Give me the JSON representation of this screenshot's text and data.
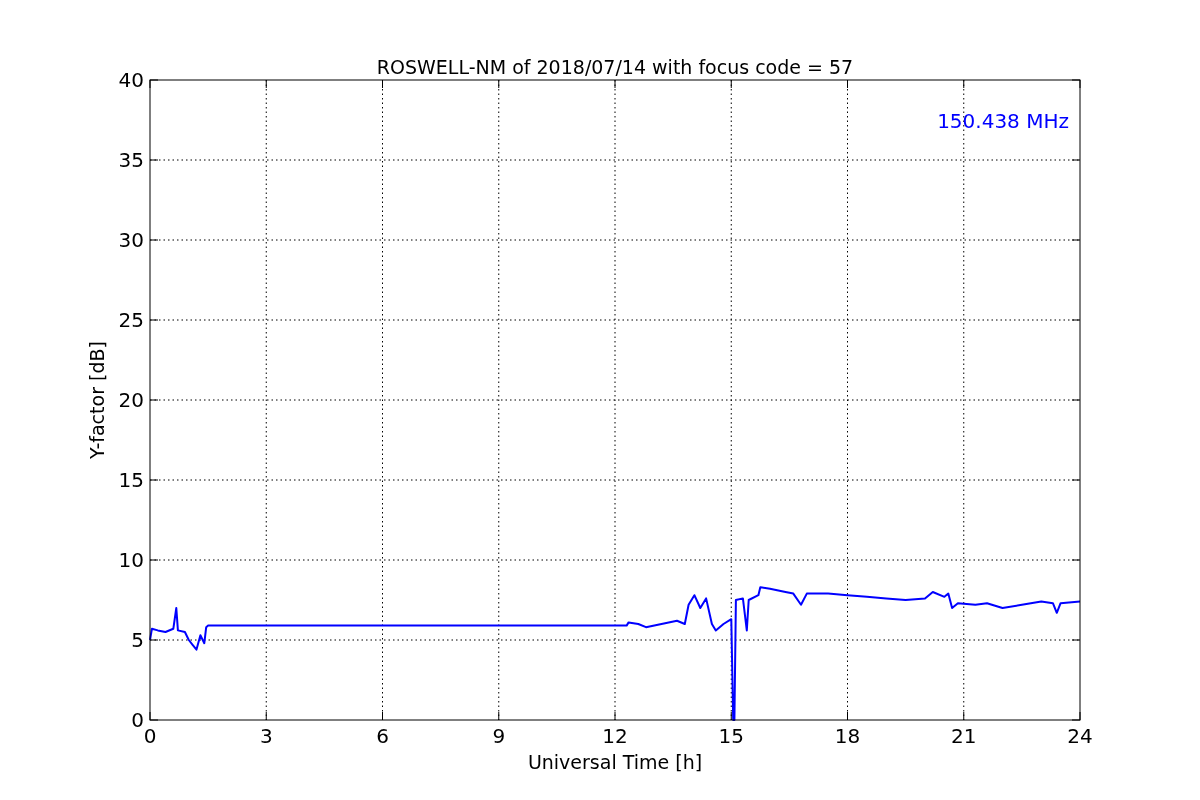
{
  "chart_data": {
    "type": "line",
    "title": "ROSWELL-NM of 2018/07/14 with focus code = 57",
    "xlabel": "Universal Time [h]",
    "ylabel": "Y-factor [dB]",
    "xlim": [
      0,
      24
    ],
    "ylim": [
      0,
      40
    ],
    "xticks": [
      0,
      3,
      6,
      9,
      12,
      15,
      18,
      21,
      24
    ],
    "yticks": [
      0,
      5,
      10,
      15,
      20,
      25,
      30,
      35,
      40
    ],
    "x": [
      0,
      0.05,
      0.2,
      0.4,
      0.6,
      0.68,
      0.72,
      0.9,
      1.0,
      1.1,
      1.2,
      1.3,
      1.4,
      1.45,
      1.5,
      12.3,
      12.35,
      12.6,
      12.8,
      13.2,
      13.6,
      13.8,
      13.9,
      14.05,
      14.2,
      14.35,
      14.5,
      14.6,
      14.8,
      15.0,
      15.05,
      15.08,
      15.12,
      15.3,
      15.4,
      15.45,
      15.7,
      15.75,
      16.0,
      16.4,
      16.6,
      16.8,
      16.95,
      17.5,
      18.0,
      18.5,
      19.0,
      19.5,
      20.0,
      20.2,
      20.5,
      20.6,
      20.7,
      20.85,
      21.3,
      21.6,
      22.0,
      22.5,
      23.0,
      23.3,
      23.4,
      23.5,
      24
    ],
    "series": [
      {
        "name": "150.438 MHz",
        "color": "#0000ff",
        "values": [
          5.0,
          5.7,
          5.6,
          5.5,
          5.7,
          7.0,
          5.6,
          5.5,
          5.0,
          4.7,
          4.4,
          5.3,
          4.8,
          5.8,
          5.9,
          5.9,
          6.1,
          6.0,
          5.8,
          6.0,
          6.2,
          6.0,
          7.2,
          7.8,
          7.0,
          7.6,
          6.0,
          5.6,
          6.0,
          6.3,
          0,
          0,
          7.5,
          7.6,
          5.6,
          7.5,
          7.8,
          8.3,
          8.2,
          8.0,
          7.9,
          7.2,
          7.9,
          7.9,
          7.8,
          7.7,
          7.6,
          7.5,
          7.6,
          8.0,
          7.7,
          7.9,
          7.0,
          7.3,
          7.2,
          7.3,
          7.0,
          7.2,
          7.4,
          7.3,
          6.7,
          7.3,
          7.4
        ]
      }
    ],
    "grid": true
  }
}
